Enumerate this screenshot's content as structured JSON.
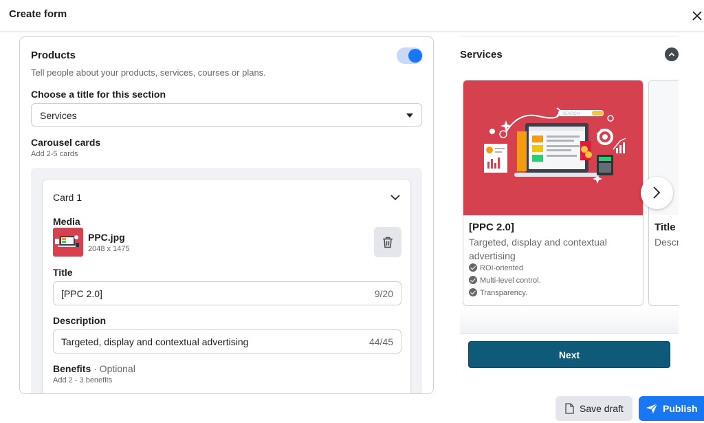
{
  "header": {
    "title": "Create form",
    "close_icon": "close-icon"
  },
  "products": {
    "title": "Products",
    "subtitle": "Tell people about your products, services, courses or plans.",
    "toggle_on": true,
    "accent_color": "#1877f2",
    "section_title_label": "Choose a title for this section",
    "section_title_value": "Services",
    "carousel_label": "Carousel cards",
    "carousel_hint": "Add 2-5 cards",
    "card": {
      "heading": "Card 1",
      "media_label": "Media",
      "file_name": "PPC.jpg",
      "file_dims": "2048 x 1475",
      "title_label": "Title",
      "title_value": "[PPC 2.0]",
      "title_count": "9/20",
      "description_label": "Description",
      "description_value": "Targeted, display and contextual advertising",
      "description_count": "44/45",
      "benefits_label": "Benefits",
      "benefits_optional": " · Optional",
      "benefits_hint": "Add 2 - 3 benefits"
    }
  },
  "preview": {
    "title": "Services",
    "cards": [
      {
        "title": "[PPC 2.0]",
        "description": "Targeted, display and contextual advertising",
        "benefits": [
          "ROI-oriented",
          "Multi-level control.",
          "Transparency."
        ],
        "image_color": "#d5414e",
        "image_search_text": "SEARCH"
      },
      {
        "title": "Title",
        "description": "Descr"
      }
    ],
    "next_button": "Next",
    "button_color": "#0f5a78"
  },
  "footer": {
    "save_draft": "Save draft",
    "publish": "Publish"
  }
}
